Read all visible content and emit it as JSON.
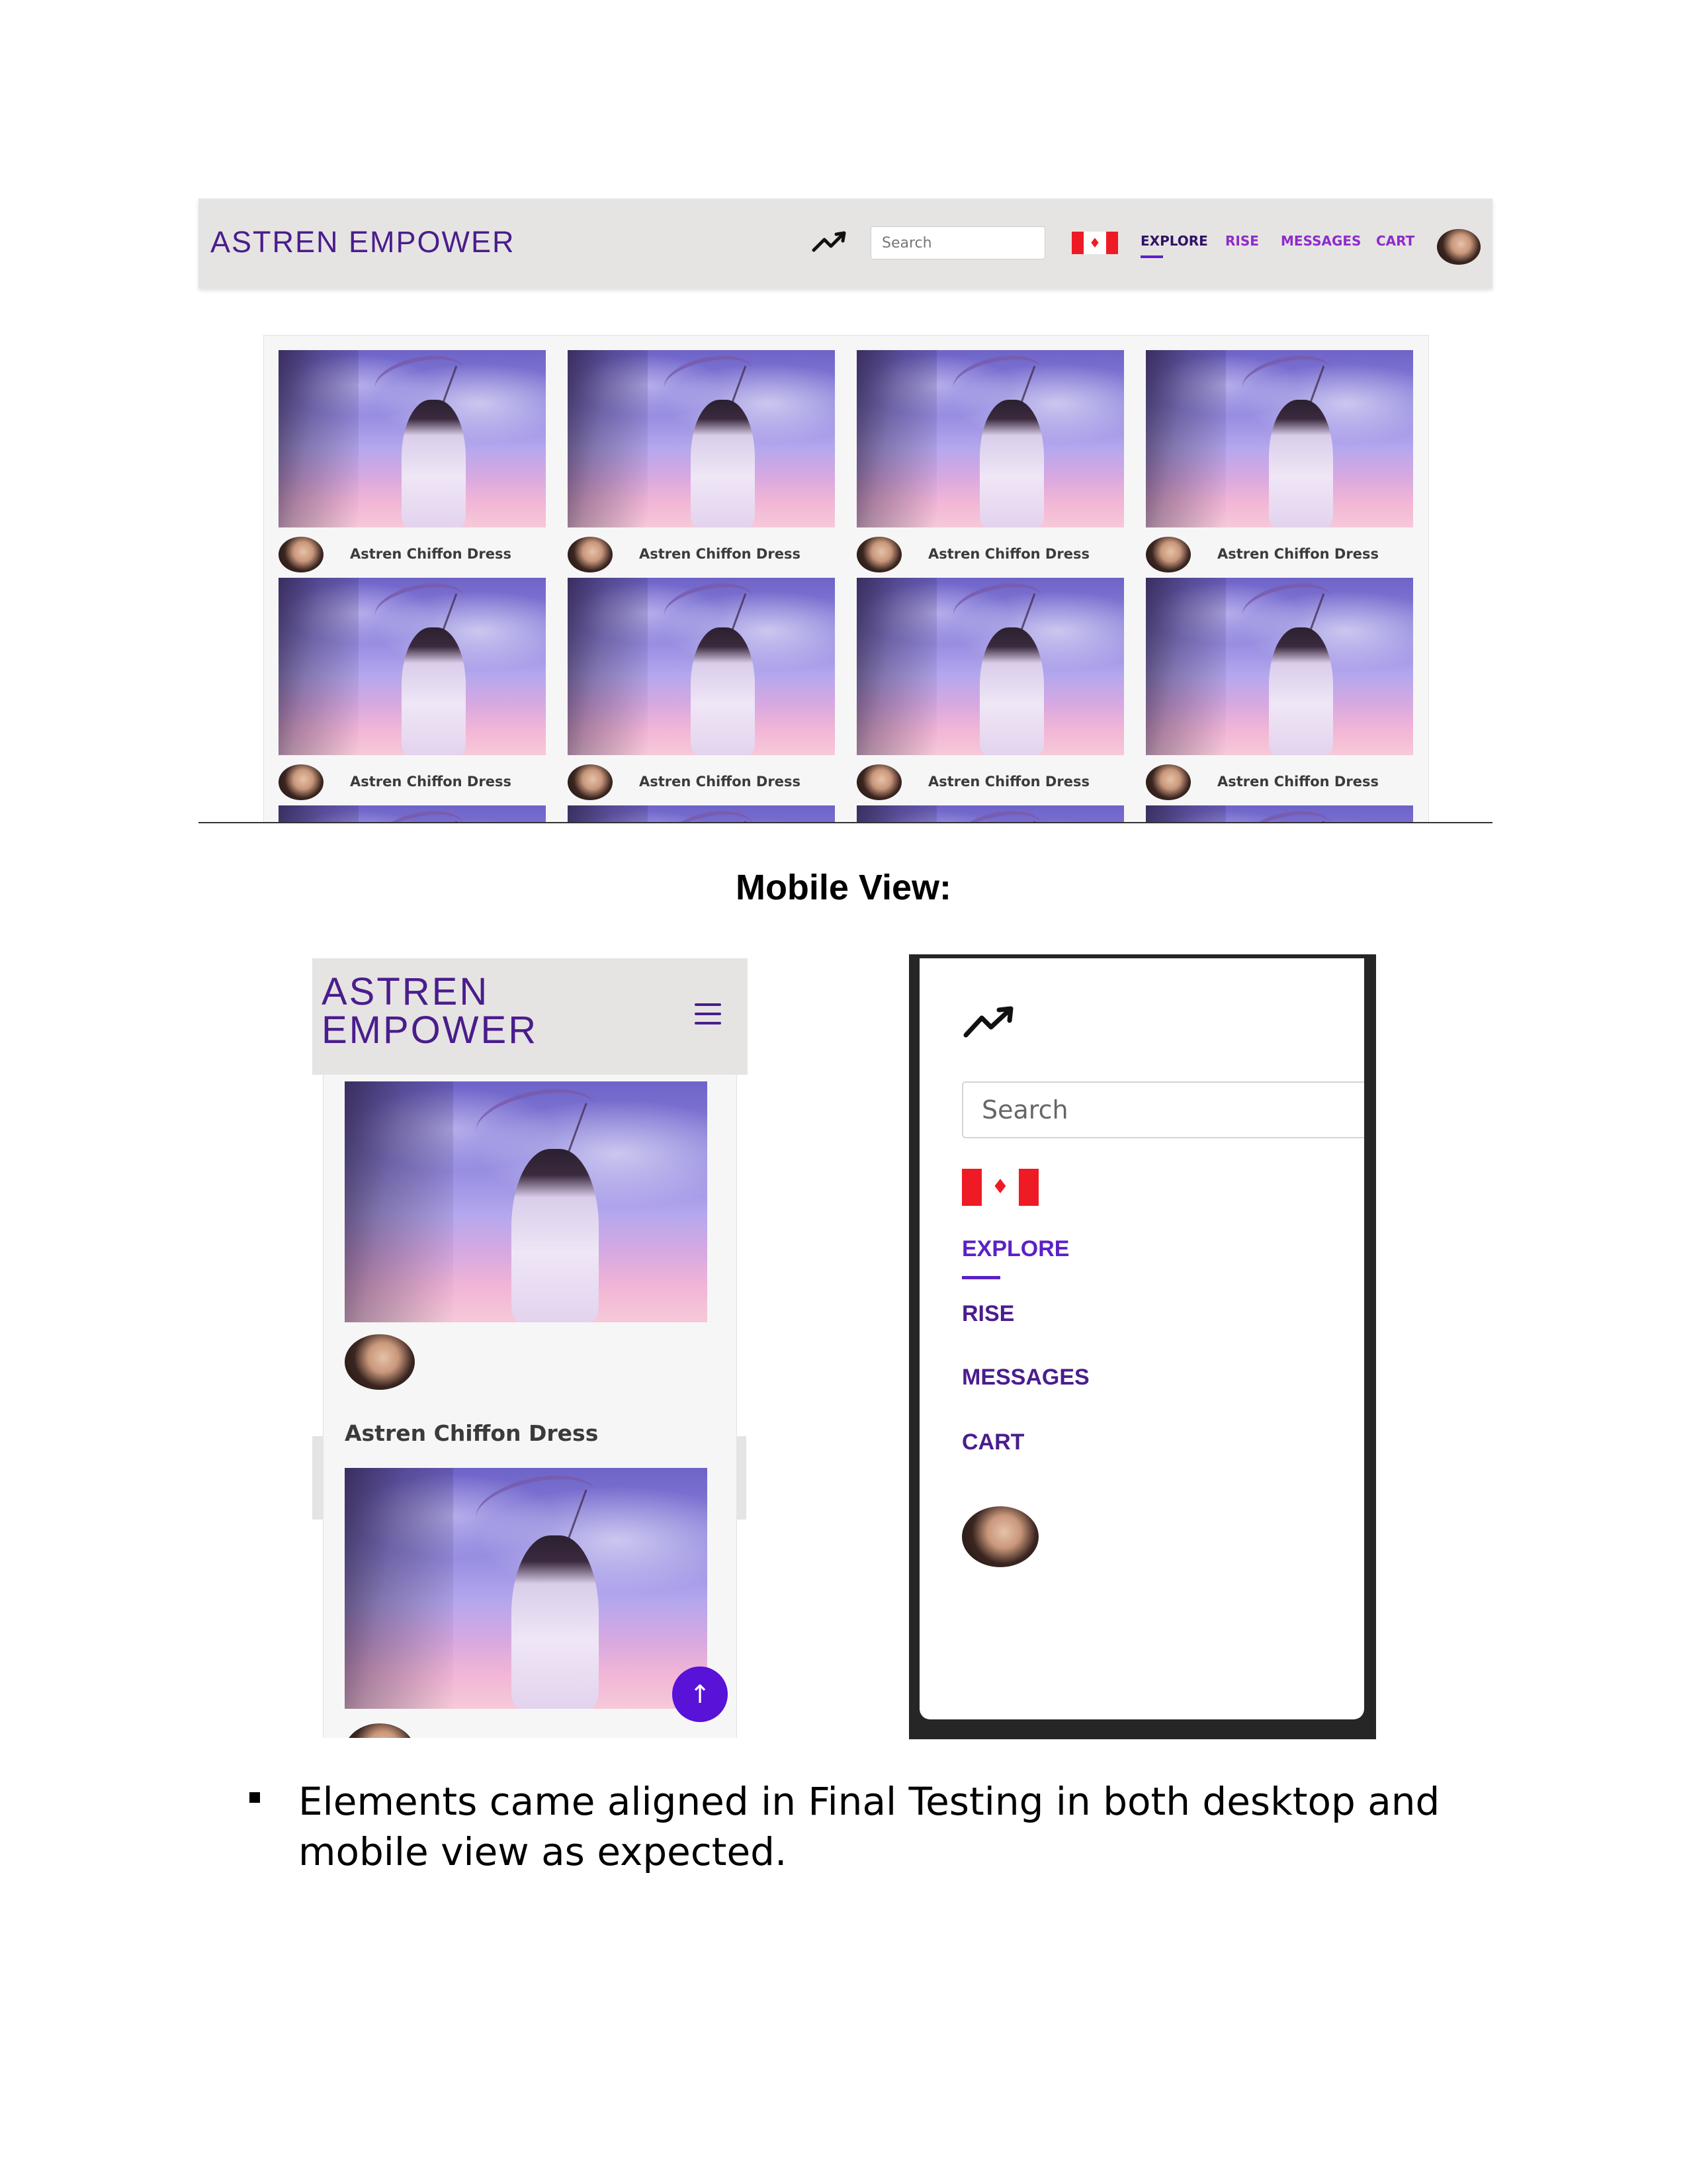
{
  "desktop": {
    "brand": "ASTREN EMPOWER",
    "search_placeholder": "Search",
    "nav": {
      "explore": "EXPLORE",
      "rise": "RISE",
      "messages": "MESSAGES",
      "cart": "CART"
    },
    "card_title": "Astren Chiffon Dress"
  },
  "section_heading": "Mobile View:",
  "mobile": {
    "brand_line1": "ASTREN",
    "brand_line2": "EMPOWER",
    "card_title": "Astren Chiffon Dress",
    "scroll_top_glyph": "↑"
  },
  "mobile_menu": {
    "search_placeholder": "Search",
    "items": {
      "explore": "EXPLORE",
      "rise": "RISE",
      "messages": "MESSAGES",
      "cart": "CART"
    }
  },
  "bullet": {
    "text": "Elements came aligned in Final Testing in both desktop and mobile view as expected."
  },
  "colors": {
    "brand_purple": "#4a1d8c",
    "nav_purple": "#8e2cc9",
    "accent_violet": "#5b21c6",
    "scroll_button": "#5812d8",
    "header_grey": "#e6e4e3",
    "flag_red": "#ee1b24"
  },
  "icons": [
    "trending-up-icon",
    "canada-flag-icon",
    "user-avatar",
    "hamburger-menu-icon",
    "arrow-up-icon"
  ]
}
